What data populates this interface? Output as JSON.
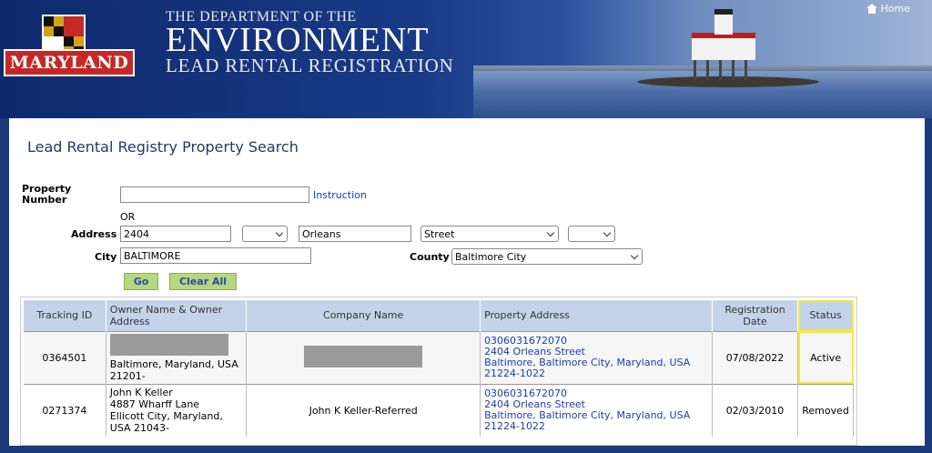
{
  "header": {
    "logo_text": "MARYLAND",
    "dept_line": "THE DEPARTMENT OF THE",
    "main_line": "ENVIRONMENT",
    "sub_line": "LEAD RENTAL REGISTRATION",
    "home_label": "Home"
  },
  "page": {
    "title": "Lead Rental Registry Property Search"
  },
  "form": {
    "property_number_label": "Property Number",
    "property_number_value": "",
    "instruction_link": "Instruction",
    "or_text": "OR",
    "address_label": "Address",
    "address_number": "2404",
    "direction_value": "",
    "street_name": "Orleans",
    "street_type": "Street",
    "suffix_value": "",
    "city_label": "City",
    "city_value": "BALTIMORE",
    "county_label": "County",
    "county_value": "Baltimore City",
    "go_label": "Go",
    "clear_label": "Clear All"
  },
  "table": {
    "headers": {
      "tracking_id": "Tracking ID",
      "owner": "Owner Name & Owner Address",
      "company": "Company Name",
      "property": "Property Address",
      "reg_date": "Registration Date",
      "status": "Status"
    },
    "rows": [
      {
        "tracking_id": "0364501",
        "owner_name": "",
        "owner_line2": "",
        "owner_line3": "Baltimore, Maryland, USA 21201-",
        "company": "",
        "prop_number": "0306031672070",
        "prop_street": "2404 Orleans Street",
        "prop_city": "Baltimore, Baltimore City, Maryland, USA",
        "prop_zip": "21224-1022",
        "reg_date": "07/08/2022",
        "status": "Active"
      },
      {
        "tracking_id": "0271374",
        "owner_name": "John K Keller",
        "owner_line2": "4887 Wharff Lane",
        "owner_line3": "Ellicott City, Maryland, USA 21043-",
        "company": "John K Keller-Referred",
        "prop_number": "0306031672070",
        "prop_street": "2404 Orleans Street",
        "prop_city": "Baltimore, Baltimore City, Maryland, USA",
        "prop_zip": "21224-1022",
        "reg_date": "02/03/2010",
        "status": "Removed"
      }
    ]
  },
  "colors": {
    "banner": "#1a3a86",
    "button": "#b6d680",
    "link": "#1a3fa6",
    "table_header": "#c5d3ea",
    "highlight": "#f2ea3a"
  }
}
